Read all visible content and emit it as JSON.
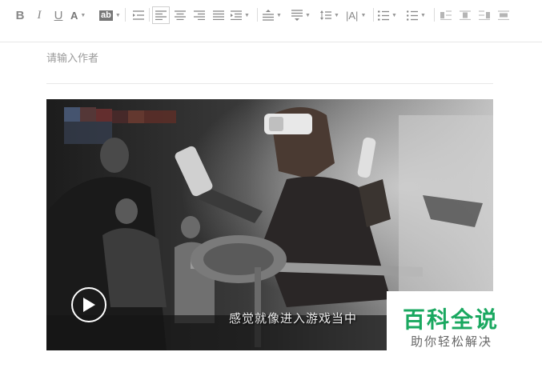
{
  "toolbar": {
    "bold": "B",
    "italic": "I",
    "underline": "U",
    "font_color": "A",
    "highlight": "ab",
    "spacing_label": "|A|"
  },
  "editor": {
    "author_placeholder": "请输入作者"
  },
  "video": {
    "subtitle": "感觉就像进入游戏当中"
  },
  "watermark": {
    "title": "百科全说",
    "subtitle": "助你轻松解决"
  },
  "colors": {
    "watermark_green": "#1aa860",
    "toolbar_icon": "#888888"
  }
}
